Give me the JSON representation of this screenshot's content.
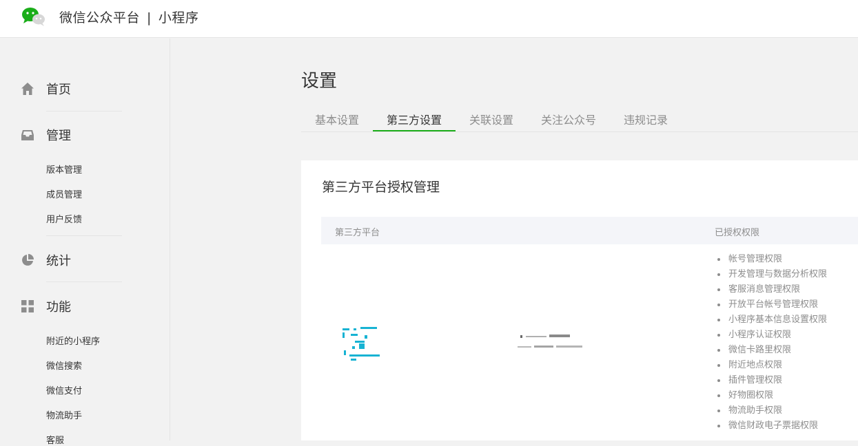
{
  "header": {
    "brand": "微信公众平台",
    "separator": "|",
    "product": "小程序"
  },
  "sidebar": {
    "home": {
      "label": "首页",
      "icon": "home-icon"
    },
    "manage": {
      "label": "管理",
      "icon": "inbox-icon",
      "items": [
        "版本管理",
        "成员管理",
        "用户反馈"
      ]
    },
    "stats": {
      "label": "统计",
      "icon": "pie-chart-icon"
    },
    "features": {
      "label": "功能",
      "icon": "grid-icon",
      "items": [
        "附近的小程序",
        "微信搜索",
        "微信支付",
        "物流助手",
        "客服"
      ]
    }
  },
  "page": {
    "title": "设置",
    "tabs": [
      "基本设置",
      "第三方设置",
      "关联设置",
      "关注公众号",
      "违规记录"
    ],
    "active_tab": "第三方设置"
  },
  "card": {
    "title": "第三方平台授权管理",
    "columns": {
      "platform": "第三方平台",
      "permissions": "已授权权限"
    },
    "permissions": [
      "帐号管理权限",
      "开发管理与数据分析权限",
      "客服消息管理权限",
      "开放平台帐号管理权限",
      "小程序基本信息设置权限",
      "小程序认证权限",
      "微信卡路里权限",
      "附近地点权限",
      "插件管理权限",
      "好物圈权限",
      "物流助手权限",
      "微信财政电子票据权限"
    ]
  },
  "colors": {
    "accent": "#1aad19",
    "text": "#353535",
    "muted": "#8d8d8d",
    "page_bg": "#f2f2f2"
  }
}
